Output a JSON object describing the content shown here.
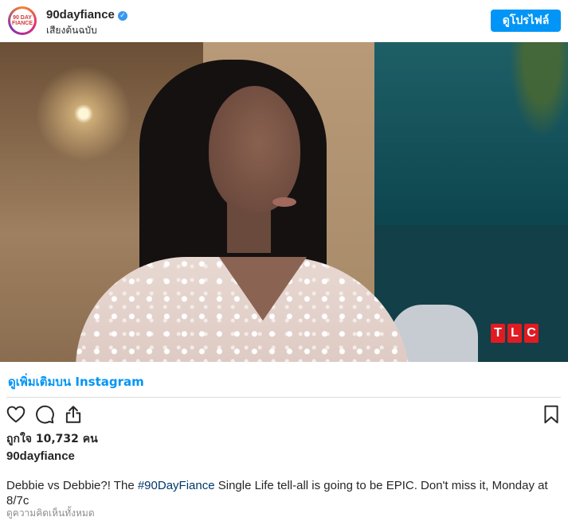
{
  "header": {
    "avatar_text": "90 DAY FIANCE",
    "username": "90dayfiance",
    "verified_mark": "✓",
    "sublabel": "เสียงต้นฉบับ",
    "profile_button": "ดูโปรไฟล์"
  },
  "media": {
    "watermark": [
      "T",
      "L",
      "C"
    ],
    "watermark_color": "#e11b22"
  },
  "footer": {
    "see_more_link": "ดูเพิ่มเติมบน Instagram",
    "actions": {
      "like_icon": "heart-icon",
      "comment_icon": "comment-icon",
      "share_icon": "share-icon",
      "save_icon": "bookmark-icon"
    },
    "likes": "ถูกใจ 10,732 คน",
    "caption_user": "90dayfiance",
    "caption_before": "Debbie vs Debbie?! The ",
    "caption_hashtag": "#90DayFiance",
    "caption_after": " Single Life tell-all is going to be EPIC. Don't miss it, Monday at 8/7c",
    "caption_more": "ดูความคิดเห็นทั้งหมด"
  },
  "colors": {
    "accent": "#0095f6",
    "hashtag": "#00376b",
    "text": "#262626",
    "divider": "#dbdbdb"
  }
}
